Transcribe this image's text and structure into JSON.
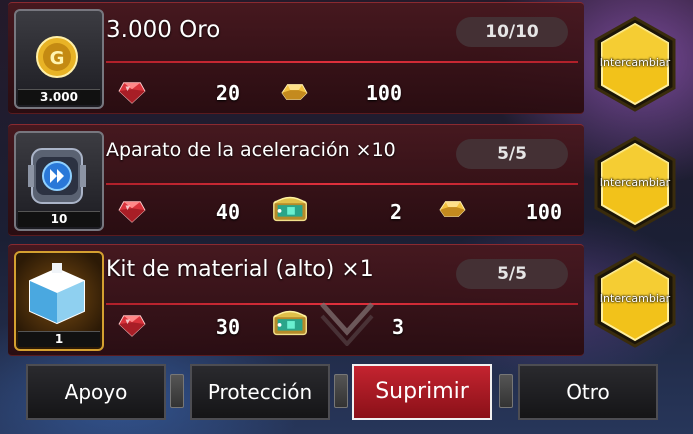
{
  "colors": {
    "row_bg": "#3a1217",
    "divider": "#e0303c",
    "exchange_gold": "#f2c21a",
    "tab_active": "#c42430"
  },
  "offers": [
    {
      "item_icon": "gold-coin-icon",
      "item_qty": "3.000",
      "title": "3.000 Oro",
      "limit": "10/10",
      "costs": [
        {
          "icon": "red-gem-icon",
          "value": "20"
        },
        {
          "icon": "gold-ingot-icon",
          "value": "100"
        }
      ],
      "button": "Intercambiar"
    },
    {
      "item_icon": "accelerator-device-icon",
      "item_qty": "10",
      "title": "Aparato de la aceleración ×10",
      "limit": "5/5",
      "costs": [
        {
          "icon": "red-gem-icon",
          "value": "40"
        },
        {
          "icon": "treasure-chest-icon",
          "value": "2"
        },
        {
          "icon": "gold-ingot-icon",
          "value": "100"
        }
      ],
      "button": "Intercambiar"
    },
    {
      "item_icon": "material-kit-icon",
      "item_qty": "1",
      "title": "Kit de material (alto) ×1",
      "limit": "5/5",
      "costs": [
        {
          "icon": "red-gem-icon",
          "value": "30"
        },
        {
          "icon": "treasure-chest-icon",
          "value": "3"
        }
      ],
      "button": "Intercambiar"
    }
  ],
  "tabs": [
    {
      "label": "Apoyo",
      "active": false
    },
    {
      "label": "Protección",
      "active": false
    },
    {
      "label": "Suprimir",
      "active": true
    },
    {
      "label": "Otro",
      "active": false
    }
  ]
}
